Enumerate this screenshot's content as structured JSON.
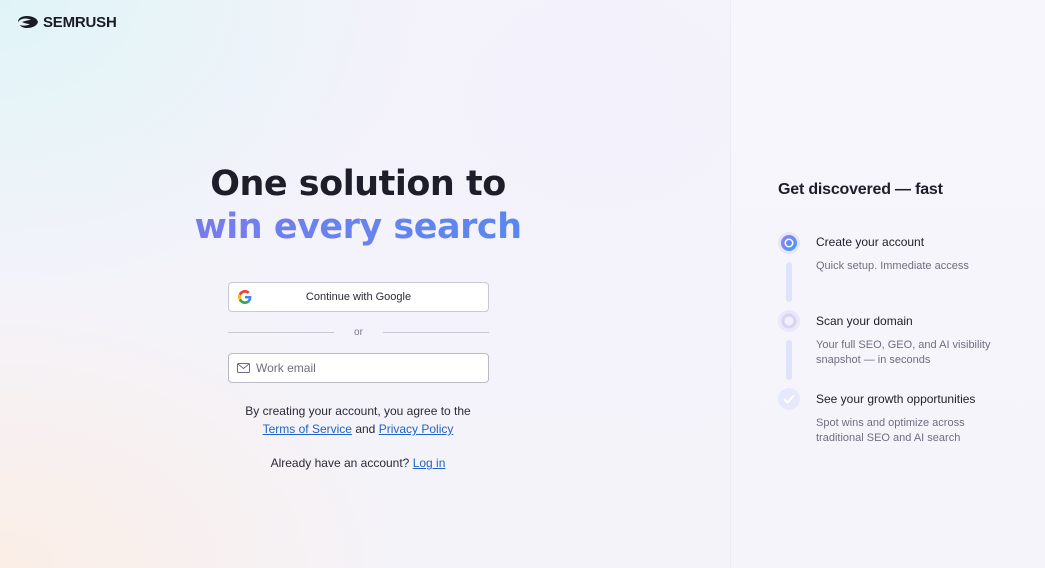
{
  "brand": {
    "name": "SEMRUSH"
  },
  "hero": {
    "line1": "One solution to",
    "line2": "win every search"
  },
  "auth": {
    "google_label": "Continue with Google",
    "divider_text": "or",
    "email_placeholder": "Work email",
    "email_value": "",
    "terms_prefix": "By creating your account, you agree to the",
    "terms_link": "Terms of Service",
    "terms_and": "and",
    "privacy_link": "Privacy Policy",
    "login_prompt": "Already have an account?",
    "login_link": "Log in"
  },
  "panel": {
    "title": "Get discovered — fast",
    "steps": [
      {
        "title": "Create your account",
        "desc": "Quick setup. Immediate access",
        "state": "active"
      },
      {
        "title": "Scan your domain",
        "desc": "Your full SEO, GEO, and AI visibility snapshot — in seconds",
        "state": "pending"
      },
      {
        "title": "See your growth opportunities",
        "desc": "Spot wins and optimize across traditional SEO and AI search",
        "state": "pending"
      }
    ]
  },
  "icons": {
    "logo": "semrush-flame-icon",
    "google": "google-icon",
    "email": "mail-icon",
    "step_active": "active-step-icon",
    "step_pending": "pending-step-icon",
    "step_check": "check-step-icon"
  },
  "colors": {
    "link": "#1f63c9",
    "gradient_start": "#8e72e6",
    "gradient_end": "#4a8cf0"
  }
}
